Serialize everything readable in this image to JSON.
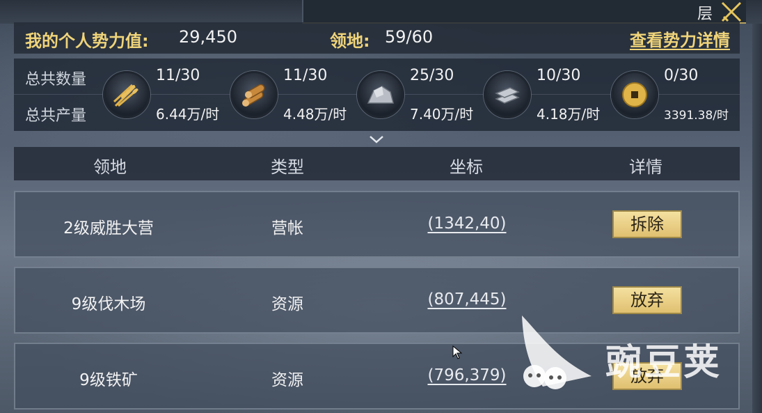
{
  "top_bar": {
    "partial_text": "层"
  },
  "summary": {
    "influence_label": "我的个人势力值:",
    "influence_value": "29,450",
    "territory_label": "领地:",
    "territory_value": "59/60",
    "details_link": "查看势力详情"
  },
  "resources": {
    "count_label": "总共数量",
    "production_label": "总共产量",
    "items": [
      {
        "icon": "wheat-icon",
        "count": "11/30",
        "production": "6.44万/时"
      },
      {
        "icon": "wood-icon",
        "count": "11/30",
        "production": "4.48万/时"
      },
      {
        "icon": "stone-icon",
        "count": "25/30",
        "production": "7.40万/时"
      },
      {
        "icon": "iron-icon",
        "count": "10/30",
        "production": "4.18万/时"
      },
      {
        "icon": "coin-icon",
        "count": "0/30",
        "production": "3391.38/时"
      }
    ]
  },
  "table": {
    "headers": [
      "领地",
      "类型",
      "坐标",
      "详情"
    ],
    "rows": [
      {
        "territory": "2级威胜大营",
        "type": "营帐",
        "coords": "(1342,40)",
        "action": "拆除"
      },
      {
        "territory": "9级伐木场",
        "type": "资源",
        "coords": "(807,445)",
        "action": "放弃"
      },
      {
        "territory": "9级铁矿",
        "type": "资源",
        "coords": "(796,379)",
        "action": "放弃"
      }
    ]
  },
  "watermark": {
    "text": "豌豆荚"
  },
  "colors": {
    "gold": "#f0d47a",
    "button_gold": "#e8cc80",
    "panel_dark": "#242c38"
  }
}
